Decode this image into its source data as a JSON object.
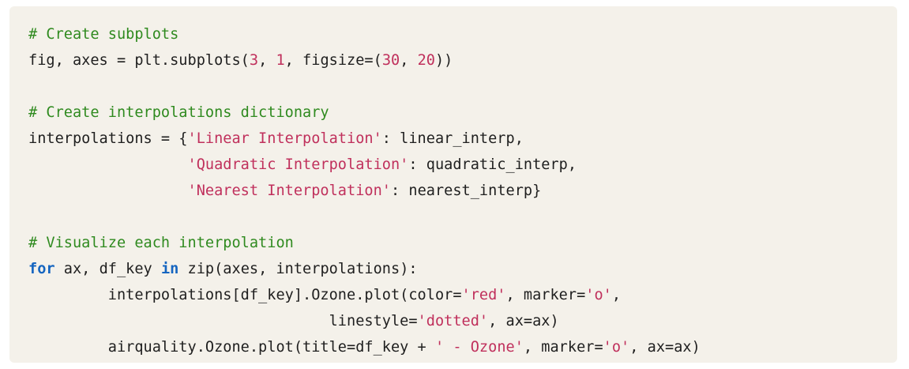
{
  "code_block": {
    "colors": {
      "background": "#f4f1ea",
      "plain": "#1f1f1f",
      "comment": "#2f8a1f",
      "string": "#c0305c",
      "number": "#c0305c",
      "keyword": "#1565c0"
    },
    "lines": [
      [
        {
          "t": "comment",
          "v": "# Create subplots"
        }
      ],
      [
        {
          "t": "plain",
          "v": "fig, axes = plt.subplots("
        },
        {
          "t": "number",
          "v": "3"
        },
        {
          "t": "plain",
          "v": ", "
        },
        {
          "t": "number",
          "v": "1"
        },
        {
          "t": "plain",
          "v": ", figsize=("
        },
        {
          "t": "number",
          "v": "30"
        },
        {
          "t": "plain",
          "v": ", "
        },
        {
          "t": "number",
          "v": "20"
        },
        {
          "t": "plain",
          "v": "))"
        }
      ],
      [],
      [
        {
          "t": "comment",
          "v": "# Create interpolations dictionary"
        }
      ],
      [
        {
          "t": "plain",
          "v": "interpolations = {"
        },
        {
          "t": "string",
          "v": "'Linear Interpolation'"
        },
        {
          "t": "plain",
          "v": ": linear_interp,"
        }
      ],
      [
        {
          "t": "plain",
          "v": "                  "
        },
        {
          "t": "string",
          "v": "'Quadratic Interpolation'"
        },
        {
          "t": "plain",
          "v": ": quadratic_interp,"
        }
      ],
      [
        {
          "t": "plain",
          "v": "                  "
        },
        {
          "t": "string",
          "v": "'Nearest Interpolation'"
        },
        {
          "t": "plain",
          "v": ": nearest_interp}"
        }
      ],
      [],
      [
        {
          "t": "comment",
          "v": "# Visualize each interpolation"
        }
      ],
      [
        {
          "t": "keyword",
          "v": "for"
        },
        {
          "t": "plain",
          "v": " ax, df_key "
        },
        {
          "t": "keyword",
          "v": "in"
        },
        {
          "t": "plain",
          "v": " zip(axes, interpolations):"
        }
      ],
      [
        {
          "t": "plain",
          "v": "         interpolations[df_key].Ozone.plot(color="
        },
        {
          "t": "string",
          "v": "'red'"
        },
        {
          "t": "plain",
          "v": ", marker="
        },
        {
          "t": "string",
          "v": "'o'"
        },
        {
          "t": "plain",
          "v": ","
        }
      ],
      [
        {
          "t": "plain",
          "v": "                                  linestyle="
        },
        {
          "t": "string",
          "v": "'dotted'"
        },
        {
          "t": "plain",
          "v": ", ax=ax)"
        }
      ],
      [
        {
          "t": "plain",
          "v": "         airquality.Ozone.plot(title=df_key + "
        },
        {
          "t": "string",
          "v": "' - Ozone'"
        },
        {
          "t": "plain",
          "v": ", marker="
        },
        {
          "t": "string",
          "v": "'o'"
        },
        {
          "t": "plain",
          "v": ", ax=ax)"
        }
      ]
    ]
  }
}
